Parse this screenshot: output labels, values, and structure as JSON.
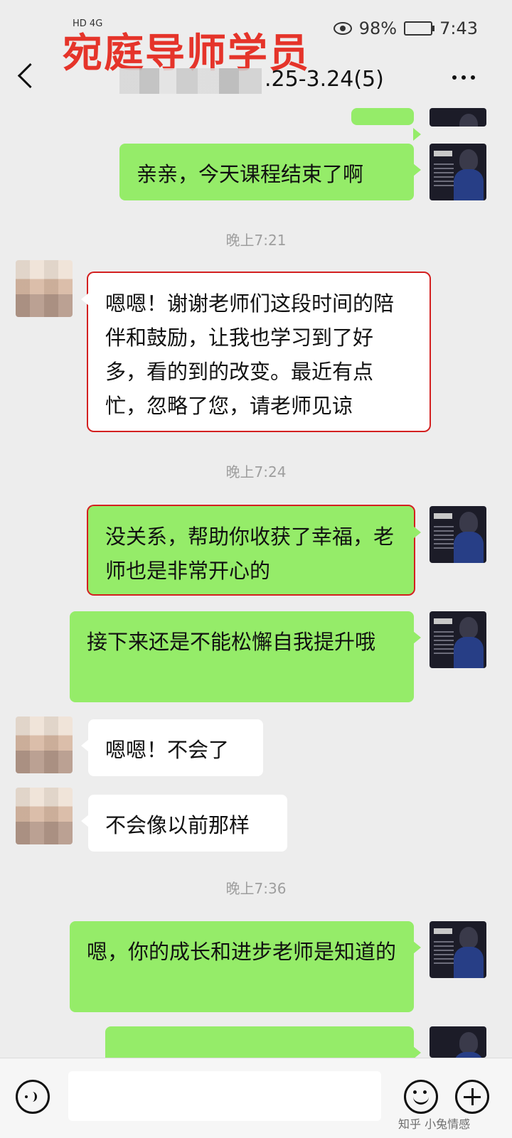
{
  "overlay_title": "宛庭导师学员",
  "status_bar": {
    "network": "HD 4G",
    "battery": "98%",
    "time": "7:43"
  },
  "header": {
    "title_partial": ".25-3.24(5)"
  },
  "timestamps": {
    "t1": "晚上7:21",
    "t2": "晚上7:24",
    "t3": "晚上7:36"
  },
  "messages": [
    {
      "side": "right",
      "text": "亲亲，今天课程结束了啊"
    },
    {
      "side": "left",
      "text": "嗯嗯！谢谢老师们这段时间的陪伴和鼓励，让我也学习到了好多，看的到的改变。最近有点忙，忽略了您，请老师见谅"
    },
    {
      "side": "right",
      "text": "没关系，帮助你收获了幸福，老师也是非常开心的"
    },
    {
      "side": "right",
      "text": "接下来还是不能松懈自我提升哦"
    },
    {
      "side": "left",
      "text": "嗯嗯！不会了"
    },
    {
      "side": "left",
      "text": "不会像以前那样"
    },
    {
      "side": "right",
      "text": "嗯，你的成长和进步老师是知道的"
    }
  ],
  "watermark": "知乎 小兔情感"
}
